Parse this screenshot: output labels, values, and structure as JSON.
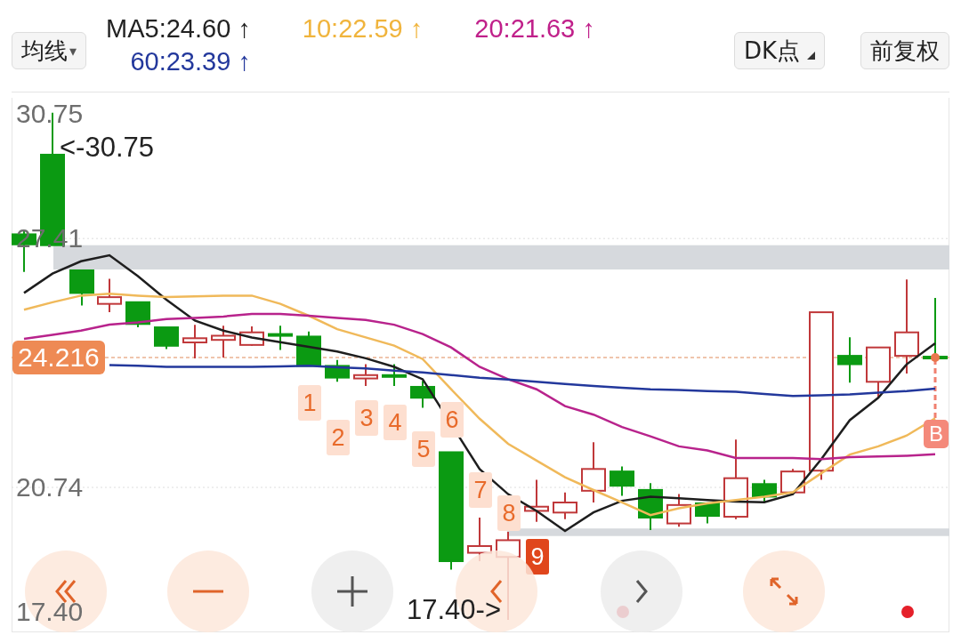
{
  "toolbar": {
    "ma_menu": {
      "label": "均线",
      "caret": "▾"
    },
    "ma_values": [
      {
        "label": "MA5:24.60",
        "arrow": "↑",
        "color": "#222222"
      },
      {
        "label": "10:22.59",
        "arrow": "↑",
        "color": "#f0b43c"
      },
      {
        "label": "20:21.63",
        "arrow": "↑",
        "color": "#c0208a"
      },
      {
        "label": "60:23.39",
        "arrow": "↑",
        "color": "#23389c"
      }
    ],
    "dk_button": {
      "label": "DK点"
    },
    "adjust_button": {
      "label": "前复权"
    }
  },
  "chart": {
    "chart_data": {
      "type": "line",
      "ylim": [
        16.88,
        31.18
      ],
      "yticks": [
        {
          "value": 30.75,
          "label": "30.75"
        },
        {
          "value": 27.41,
          "label": "27.41"
        },
        {
          "value": 20.74,
          "label": "20.74"
        },
        {
          "value": 17.4,
          "label": "17.40"
        }
      ],
      "series": [
        {
          "color": "#1e1e1e",
          "values": [
            25.95,
            26.47,
            26.8,
            26.96,
            26.4,
            25.77,
            25.21,
            24.94,
            24.76,
            24.63,
            24.51,
            24.38,
            24.2,
            23.97,
            23.64,
            null,
            21.23,
            20.56,
            20.11,
            19.57,
            20.07,
            20.38,
            20.49,
            20.45,
            20.4,
            20.36,
            20.34,
            20.56,
            21.5,
            22.54,
            23.14,
            24.04,
            24.6
          ]
        },
        {
          "color": "#f0b95a",
          "values": [
            25.5,
            25.7,
            25.88,
            25.93,
            25.88,
            25.84,
            25.86,
            25.88,
            25.88,
            25.66,
            25.34,
            24.98,
            24.76,
            24.54,
            24.18,
            23.37,
            22.58,
            21.91,
            21.46,
            21.01,
            20.67,
            20.34,
            20.0,
            20.18,
            20.31,
            20.4,
            20.49,
            20.61,
            21.12,
            21.62,
            21.84,
            22.13,
            22.59
          ]
        },
        {
          "color": "#b8238c",
          "values": [
            24.72,
            24.83,
            24.94,
            25.1,
            25.16,
            25.25,
            25.28,
            25.32,
            25.39,
            25.39,
            25.34,
            25.28,
            25.23,
            25.1,
            24.85,
            24.49,
            23.97,
            23.64,
            23.37,
            22.92,
            22.69,
            22.36,
            22.11,
            21.84,
            21.73,
            21.53,
            21.53,
            21.53,
            21.5,
            21.55,
            21.57,
            21.59,
            21.63
          ]
        },
        {
          "color": "#23389c",
          "values": [
            null,
            null,
            null,
            24.02,
            24.0,
            23.97,
            23.97,
            23.97,
            23.97,
            23.98,
            24.0,
            23.96,
            23.93,
            23.87,
            23.82,
            23.75,
            23.68,
            23.63,
            23.57,
            23.51,
            23.46,
            23.41,
            23.37,
            23.35,
            23.32,
            23.3,
            23.24,
            23.19,
            23.21,
            23.23,
            23.28,
            23.32,
            23.39
          ]
        }
      ]
    },
    "high_marker": "<-30.75",
    "low_marker": "17.40->",
    "current_price": "24.216",
    "signal_counts": [
      {
        "label": "1",
        "highlight": false
      },
      {
        "label": "2",
        "highlight": false
      },
      {
        "label": "3",
        "highlight": false
      },
      {
        "label": "4",
        "highlight": false
      },
      {
        "label": "5",
        "highlight": false
      },
      {
        "label": "6",
        "highlight": false
      },
      {
        "label": "7",
        "highlight": false
      },
      {
        "label": "8",
        "highlight": false
      },
      {
        "label": "9",
        "highlight": true
      }
    ],
    "signal_badge": "B"
  },
  "controls": [
    {
      "kind": "rewind",
      "disabled": false
    },
    {
      "kind": "zoom-out",
      "disabled": false
    },
    {
      "kind": "zoom-in",
      "disabled": true
    },
    {
      "kind": "previous",
      "disabled": false
    },
    {
      "kind": "next",
      "disabled": true
    },
    {
      "kind": "expand",
      "disabled": false
    }
  ]
}
